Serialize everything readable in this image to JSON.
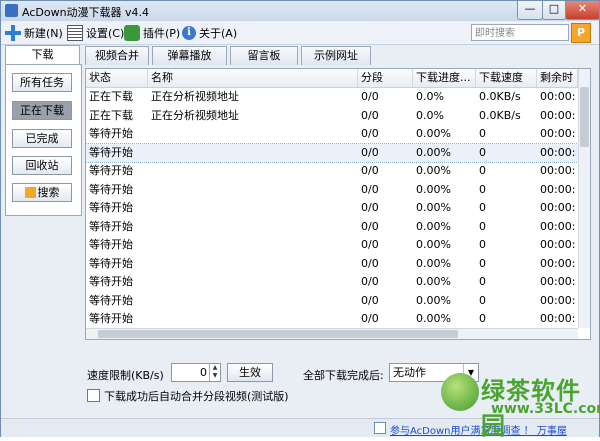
{
  "window": {
    "title": "AcDown动漫下载器 v4.4",
    "min_label": "—",
    "max_label": "□",
    "close_label": "✕"
  },
  "toolbar": {
    "new_label": "新建(N)",
    "settings_label": "设置(C)",
    "plugins_label": "插件(P)",
    "about_label": "关于(A)",
    "info_icon_glyph": "i",
    "search_placeholder": "即时搜索",
    "search_icon_glyph": "P"
  },
  "tabs": [
    "下载",
    "视频合并",
    "弹幕播放",
    "留言板",
    "示例网址"
  ],
  "sidebar": {
    "items": [
      "所有任务",
      "正在下载",
      "已完成",
      "回收站",
      "搜索"
    ],
    "active_index": 1
  },
  "table": {
    "columns": [
      "状态",
      "名称",
      "分段",
      "下载进度...",
      "下载速度",
      "剩余时"
    ],
    "rows": [
      [
        "正在下载",
        "正在分析视频地址",
        "0/0",
        "0.0%",
        "0.0KB/s",
        "00:00:"
      ],
      [
        "正在下载",
        "正在分析视频地址",
        "0/0",
        "0.0%",
        "0.0KB/s",
        "00:00:"
      ],
      [
        "等待开始",
        "",
        "0/0",
        "0.00%",
        "0",
        "00:00:"
      ],
      [
        "等待开始",
        "",
        "0/0",
        "0.00%",
        "0",
        "00:00:"
      ],
      [
        "等待开始",
        "",
        "0/0",
        "0.00%",
        "0",
        "00:00:"
      ],
      [
        "等待开始",
        "",
        "0/0",
        "0.00%",
        "0",
        "00:00:"
      ],
      [
        "等待开始",
        "",
        "0/0",
        "0.00%",
        "0",
        "00:00:"
      ],
      [
        "等待开始",
        "",
        "0/0",
        "0.00%",
        "0",
        "00:00:"
      ],
      [
        "等待开始",
        "",
        "0/0",
        "0.00%",
        "0",
        "00:00:"
      ],
      [
        "等待开始",
        "",
        "0/0",
        "0.00%",
        "0",
        "00:00:"
      ],
      [
        "等待开始",
        "",
        "0/0",
        "0.00%",
        "0",
        "00:00:"
      ],
      [
        "等待开始",
        "",
        "0/0",
        "0.00%",
        "0",
        "00:00:"
      ],
      [
        "等待开始",
        "",
        "0/0",
        "0.00%",
        "0",
        "00:00:"
      ]
    ],
    "selected_row": 3
  },
  "bottom": {
    "speed_label": "速度限制(KB/s)",
    "speed_value": "0",
    "apply_label": "生效",
    "after_all_label": "全部下载完成后:",
    "after_all_value": "无动作",
    "merge_label": "下载成功后自动合并分段视频(测试版)"
  },
  "statusbar": {
    "link_text": "参与AcDown用户满意度调查 ！ 万事屋"
  },
  "watermark": {
    "text": "绿茶软件园",
    "url": "www.33LC.com"
  }
}
